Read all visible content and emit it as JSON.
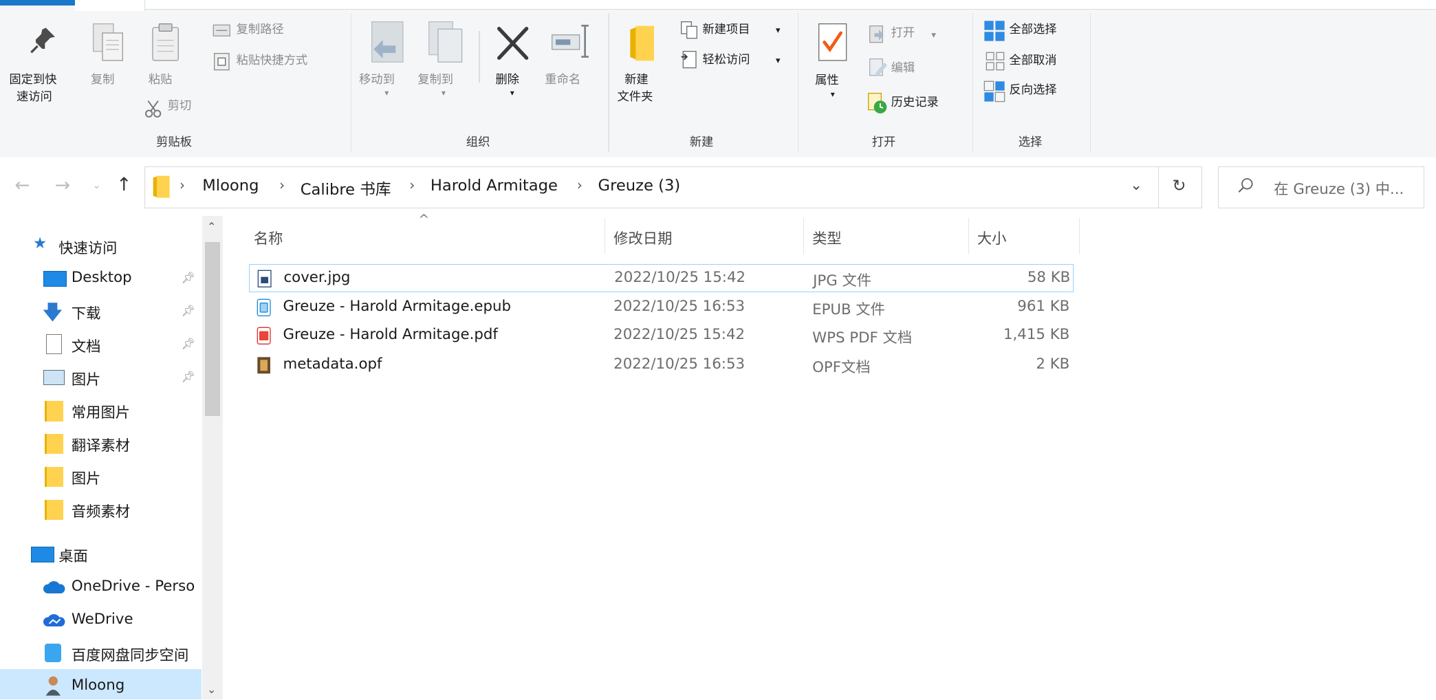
{
  "ribbon": {
    "clipboard": {
      "pin_quick_access_line1": "固定到快",
      "pin_quick_access_line2": "速访问",
      "copy": "复制",
      "paste": "粘贴",
      "copy_path": "复制路径",
      "paste_shortcut": "粘贴快捷方式",
      "cut": "剪切",
      "group_label": "剪贴板"
    },
    "organize": {
      "move_to": "移动到",
      "copy_to": "复制到",
      "delete": "删除",
      "rename": "重命名",
      "group_label": "组织"
    },
    "new": {
      "new_folder_line1": "新建",
      "new_folder_line2": "文件夹",
      "new_item": "新建项目",
      "easy_access": "轻松访问",
      "group_label": "新建"
    },
    "open": {
      "properties": "属性",
      "open": "打开",
      "edit": "编辑",
      "history": "历史记录",
      "group_label": "打开"
    },
    "select": {
      "select_all": "全部选择",
      "select_none": "全部取消",
      "invert_selection": "反向选择",
      "group_label": "选择"
    }
  },
  "address": {
    "crumbs": [
      "Mloong",
      "Calibre 书库",
      "Harold Armitage",
      "Greuze (3)"
    ],
    "search_placeholder": "在 Greuze (3) 中..."
  },
  "nav": {
    "quick_access": "快速访问",
    "quick_items": [
      {
        "label": "Desktop",
        "pinned": true,
        "icon": "desktop-icon"
      },
      {
        "label": "下载",
        "pinned": true,
        "icon": "download-icon"
      },
      {
        "label": "文档",
        "pinned": true,
        "icon": "document-icon"
      },
      {
        "label": "图片",
        "pinned": true,
        "icon": "pictures-icon"
      },
      {
        "label": "常用图片",
        "pinned": false,
        "icon": "folder-icon"
      },
      {
        "label": "翻译素材",
        "pinned": false,
        "icon": "folder-icon"
      },
      {
        "label": "图片",
        "pinned": false,
        "icon": "folder-icon"
      },
      {
        "label": "音频素材",
        "pinned": false,
        "icon": "folder-icon"
      }
    ],
    "desktop": "桌面",
    "onedrive": "OneDrive - Perso",
    "wedrive": "WeDrive",
    "baidu": "百度网盘同步空间",
    "user": "Mloong"
  },
  "files": {
    "columns": {
      "name": "名称",
      "date": "修改日期",
      "type": "类型",
      "size": "大小"
    },
    "rows": [
      {
        "name": "cover.jpg",
        "date": "2022/10/25 15:42",
        "type": "JPG 文件",
        "size": "58 KB",
        "icon": "image-file-icon"
      },
      {
        "name": "Greuze - Harold Armitage.epub",
        "date": "2022/10/25 16:53",
        "type": "EPUB 文件",
        "size": "961 KB",
        "icon": "epub-file-icon"
      },
      {
        "name": "Greuze - Harold Armitage.pdf",
        "date": "2022/10/25 15:42",
        "type": "WPS PDF 文档",
        "size": "1,415 KB",
        "icon": "pdf-file-icon"
      },
      {
        "name": "metadata.opf",
        "date": "2022/10/25 16:53",
        "type": "OPF文档",
        "size": "2 KB",
        "icon": "opf-file-icon"
      }
    ]
  },
  "colors": {
    "accent": "#1979ca",
    "selection_border": "#99d1ff",
    "folder": "#ffd34f"
  }
}
